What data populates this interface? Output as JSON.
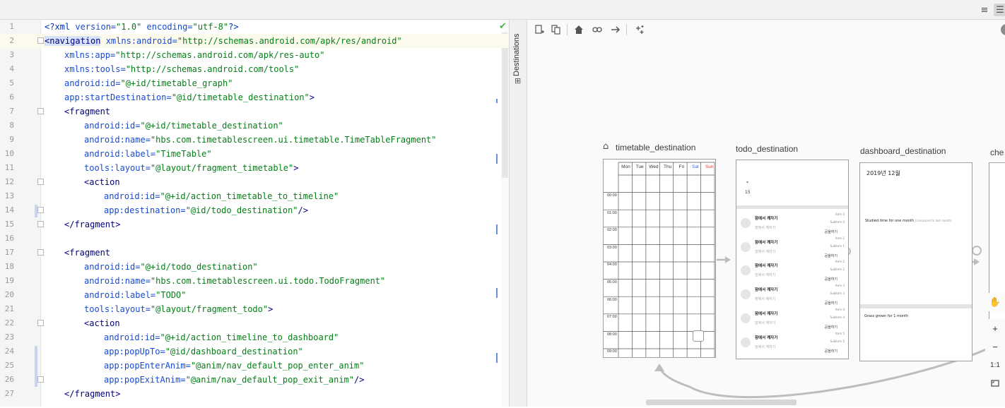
{
  "editor": {
    "lines": [
      {
        "n": "1"
      },
      {
        "n": "2"
      },
      {
        "n": "3"
      },
      {
        "n": "4"
      },
      {
        "n": "5"
      },
      {
        "n": "6"
      },
      {
        "n": "7"
      },
      {
        "n": "8"
      },
      {
        "n": "9"
      },
      {
        "n": "10"
      },
      {
        "n": "11"
      },
      {
        "n": "12"
      },
      {
        "n": "13"
      },
      {
        "n": "14"
      },
      {
        "n": "15"
      },
      {
        "n": "16"
      },
      {
        "n": "17"
      },
      {
        "n": "18"
      },
      {
        "n": "19"
      },
      {
        "n": "20"
      },
      {
        "n": "21"
      },
      {
        "n": "22"
      },
      {
        "n": "23"
      },
      {
        "n": "24"
      },
      {
        "n": "25"
      },
      {
        "n": "26"
      },
      {
        "n": "27"
      }
    ],
    "code": {
      "l1": {
        "a": "<?xml ",
        "b": "version=",
        "c": "\"1.0\" ",
        "d": "encoding=",
        "e": "\"utf-8\"",
        "f": "?>"
      },
      "l2": {
        "tag": "<navigation",
        "attr": " xmlns:android=",
        "val": "\"http://schemas.android.com/apk/res/android\""
      },
      "l3": {
        "attr": "xmlns:app=",
        "val": "\"http://schemas.android.com/apk/res-auto\""
      },
      "l4": {
        "attr": "xmlns:tools=",
        "val": "\"http://schemas.android.com/tools\""
      },
      "l5": {
        "attr": "android:id=",
        "val": "\"@+id/timetable_graph\""
      },
      "l6": {
        "attr": "app:startDestination=",
        "val": "\"@id/timetable_destination\"",
        "end": ">"
      },
      "l7": {
        "tag": "<fragment"
      },
      "l8": {
        "attr": "android:id=",
        "val": "\"@+id/timetable_destination\""
      },
      "l9": {
        "attr": "android:name=",
        "val": "\"hbs.com.timetablescreen.ui.timetable.TimeTableFragment\""
      },
      "l10": {
        "attr": "android:label=",
        "val": "\"TimeTable\""
      },
      "l11": {
        "attr": "tools:layout=",
        "val": "\"@layout/fragment_timetable\"",
        "end": ">"
      },
      "l12": {
        "tag": "<action"
      },
      "l13": {
        "attr": "android:id=",
        "val": "\"@+id/action_timetable_to_timeline\""
      },
      "l14": {
        "attr": "app:destination=",
        "val": "\"@id/todo_destination\"",
        "end": "/>"
      },
      "l15": {
        "tag": "</fragment>"
      },
      "l17": {
        "tag": "<fragment"
      },
      "l18": {
        "attr": "android:id=",
        "val": "\"@+id/todo_destination\""
      },
      "l19": {
        "attr": "android:name=",
        "val": "\"hbs.com.timetablescreen.ui.todo.TodoFragment\""
      },
      "l20": {
        "attr": "android:label=",
        "val": "\"TODO\""
      },
      "l21": {
        "attr": "tools:layout=",
        "val": "\"@layout/fragment_todo\"",
        "end": ">"
      },
      "l22": {
        "tag": "<action"
      },
      "l23": {
        "attr": "android:id=",
        "val": "\"@+id/action_timeline_to_dashboard\""
      },
      "l24": {
        "attr": "app:popUpTo=",
        "val": "\"@id/dashboard_destination\""
      },
      "l25": {
        "attr": "app:popEnterAnim=",
        "val": "\"@anim/nav_default_pop_enter_anim\""
      },
      "l26": {
        "attr": "app:popExitAnim=",
        "val": "\"@anim/nav_default_pop_exit_anim\"",
        "end": "/>"
      },
      "l27": {
        "tag": "</fragment>"
      }
    }
  },
  "side_panel": {
    "label": "Destinations"
  },
  "toolbar_icons": [
    "new-destination-icon",
    "nested-graph-icon",
    "home-icon",
    "link-icon",
    "arrow-icon",
    "auto-arrange-icon"
  ],
  "destinations": {
    "timetable": {
      "label": "timetable_destination",
      "days": [
        "Mon",
        "Tue",
        "Wed",
        "Thu",
        "Fri",
        "Sat",
        "Sun"
      ],
      "times": [
        "00:00",
        "01:00",
        "02:00",
        "03:00",
        "04:00",
        "05:00",
        "06:00",
        "07:00",
        "08:00",
        "09:00"
      ]
    },
    "todo": {
      "label": "todo_destination",
      "date_num": "15",
      "rows": [
        {
          "title": "잠에서 깨자기",
          "sub": "잠에서 깨자기",
          "m1": "Item 0",
          "m2": "Subitem 0",
          "acc": "공을하기"
        },
        {
          "title": "잠에서 깨자기",
          "sub": "잠에서 깨자기",
          "m1": "Item 1",
          "m2": "Subitem 1",
          "acc": "공을하기"
        },
        {
          "title": "잠에서 깨자기",
          "sub": "잠에서 깨자기",
          "m1": "Item 2",
          "m2": "Subitem 2",
          "acc": "공을하기"
        },
        {
          "title": "잠에서 깨자기",
          "sub": "잠에서 깨자기",
          "m1": "Item 3",
          "m2": "Subitem 3",
          "acc": "공을하기"
        },
        {
          "title": "잠에서 깨자기",
          "sub": "잠에서 깨자기",
          "m1": "Item 4",
          "m2": "Subitem 4",
          "acc": "공을하기"
        },
        {
          "title": "잠에서 깨자기",
          "sub": "잠에서 깨자기",
          "m1": "Item 5",
          "m2": "Subitem 5",
          "acc": "공을하기"
        }
      ]
    },
    "dashboard": {
      "label": "dashboard_destination",
      "month": "2019년 12월",
      "studied": "Studied time for one month",
      "compared": "(Compared to last month)",
      "grass": "Grass grown for 1 month"
    },
    "next": {
      "label": "che"
    }
  },
  "zoom": {
    "plus": "+",
    "minus": "−",
    "ratio": "1:1"
  }
}
